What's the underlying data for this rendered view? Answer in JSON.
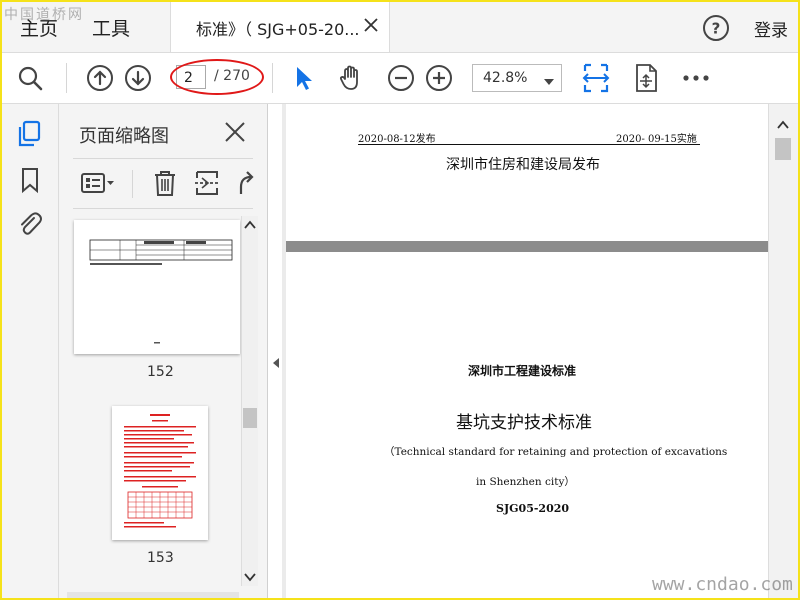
{
  "watermark_top": "中国道桥网",
  "watermark_bottom": "www.cndao.com",
  "menu": {
    "home": "主页",
    "tools": "工具"
  },
  "document_tab": {
    "title": "标准》（ SJG+05-20..."
  },
  "header": {
    "login": "登录"
  },
  "toolbar": {
    "current_page": "2",
    "total_pages": "/ 270",
    "zoom": "42.8%",
    "colors": {
      "accent": "#1473e6",
      "highlight": "#e01818"
    }
  },
  "thumbnail_panel": {
    "title": "页面缩略图",
    "thumbnails": [
      {
        "label": "152"
      },
      {
        "label": "153"
      }
    ]
  },
  "document": {
    "page_top": {
      "publish_date": "2020-08-12发布",
      "effective_date": "2020- 09-15实施",
      "publisher": "深圳市住房和建设局发布"
    },
    "page_cover": {
      "series": "深圳市工程建设标准",
      "title": "基坑支护技术标准",
      "english_line1": "（Technical standard for retaining and protection of excavations",
      "english_line2": "in Shenzhen city）",
      "code": "SJG05-2020"
    }
  }
}
